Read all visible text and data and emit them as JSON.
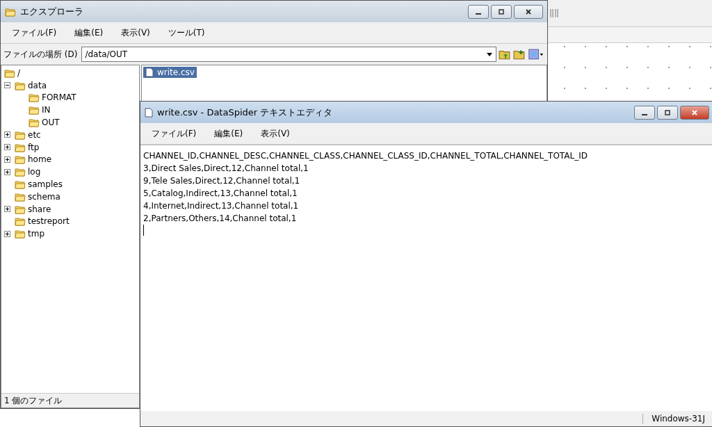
{
  "explorer": {
    "title": "エクスプローラ",
    "menu": [
      "ファイル(F)",
      "編集(E)",
      "表示(V)",
      "ツール(T)"
    ],
    "location_label": "ファイルの場所 (D)",
    "location_value": "/data/OUT",
    "tree": [
      {
        "label": "/",
        "kind": "expanded",
        "children": [
          {
            "label": "data",
            "kind": "expanded",
            "children": [
              {
                "label": "FORMAT",
                "kind": "leaf"
              },
              {
                "label": "IN",
                "kind": "leaf"
              },
              {
                "label": "OUT",
                "kind": "leaf"
              }
            ]
          },
          {
            "label": "etc",
            "kind": "collapsed"
          },
          {
            "label": "ftp",
            "kind": "collapsed"
          },
          {
            "label": "home",
            "kind": "collapsed"
          },
          {
            "label": "log",
            "kind": "collapsed"
          },
          {
            "label": "samples",
            "kind": "leaf"
          },
          {
            "label": "schema",
            "kind": "leaf"
          },
          {
            "label": "share",
            "kind": "collapsed"
          },
          {
            "label": "testreport",
            "kind": "leaf"
          },
          {
            "label": "tmp",
            "kind": "collapsed"
          }
        ]
      }
    ],
    "files": [
      {
        "name": "write.csv",
        "selected": true
      }
    ],
    "status": "1 個のファイル"
  },
  "editor": {
    "title": "write.csv - DataSpider テキストエディタ",
    "menu": [
      "ファイル(F)",
      "編集(E)",
      "表示(V)"
    ],
    "lines": [
      "CHANNEL_ID,CHANNEL_DESC,CHANNEL_CLASS,CHANNEL_CLASS_ID,CHANNEL_TOTAL,CHANNEL_TOTAL_ID",
      "3,Direct Sales,Direct,12,Channel total,1",
      "9,Tele Sales,Direct,12,Channel total,1",
      "5,Catalog,Indirect,13,Channel total,1",
      "4,Internet,Indirect,13,Channel total,1",
      "2,Partners,Others,14,Channel total,1"
    ],
    "encoding": "Windows-31J"
  }
}
